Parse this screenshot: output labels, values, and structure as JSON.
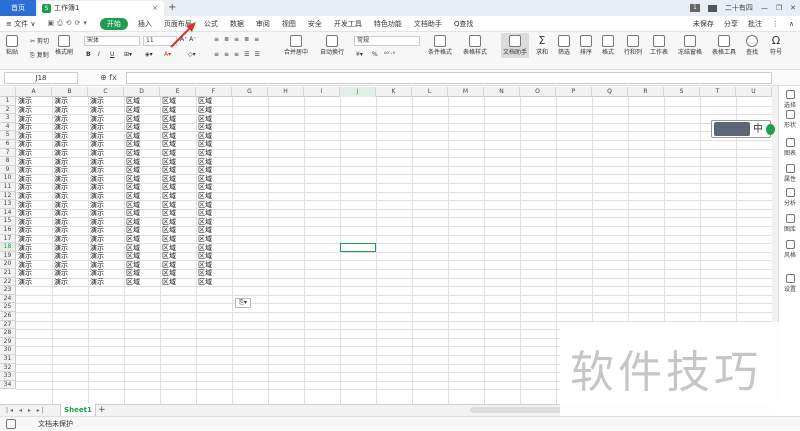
{
  "titlebar": {
    "home_tab": "首页",
    "doc_tab": "工作簿1",
    "doc_icon": "S",
    "close": "×",
    "plus": "+",
    "badge": "1",
    "user": "二十有四"
  },
  "menubar": {
    "file": "≡ 文件 ∨",
    "items": [
      "开始",
      "插入",
      "页面布局",
      "公式",
      "数据",
      "审阅",
      "视图",
      "安全",
      "开发工具",
      "特色功能",
      "文档助手",
      "Q查找"
    ],
    "active_index": 0,
    "right": [
      "未保存",
      "分享",
      "批注"
    ]
  },
  "ribbon": {
    "cut": "剪切",
    "copy": "复制",
    "paste": "粘贴",
    "format_painter": "格式刷",
    "font_name": "宋体",
    "font_size": "11",
    "bold": "B",
    "italic": "I",
    "underline": "U",
    "merge_center": "合并居中",
    "wrap": "自动换行",
    "number_format": "常规",
    "percent": "%",
    "cond_format": "条件格式",
    "table_style": "表格样式",
    "doc_helper": "文档助手",
    "sum": "求和",
    "filter": "筛选",
    "sort": "排序",
    "format": "格式",
    "rowcol": "行和列",
    "worksheet": "工作表",
    "freeze": "冻结窗格",
    "table_tools": "表格工具",
    "find": "查找",
    "symbol": "符号"
  },
  "formula": {
    "name_box": "J18",
    "fx": "fx",
    "value": ""
  },
  "grid": {
    "columns": [
      "A",
      "B",
      "C",
      "D",
      "E",
      "F",
      "G",
      "H",
      "I",
      "J",
      "K",
      "L",
      "M",
      "N",
      "O",
      "P",
      "Q",
      "R",
      "S",
      "T",
      "U"
    ],
    "rows": [
      "1",
      "2",
      "3",
      "4",
      "5",
      "6",
      "7",
      "8",
      "9",
      "10",
      "11",
      "12",
      "13",
      "14",
      "15",
      "16",
      "17",
      "18",
      "19",
      "20",
      "21",
      "22",
      "23",
      "24",
      "25",
      "26",
      "27",
      "28",
      "29",
      "30",
      "31",
      "32",
      "33",
      "34"
    ],
    "filled_rows": 22,
    "text_abc": "演示",
    "text_def": "区域",
    "selected_col_index": 9,
    "selected_row_index": 17
  },
  "paste_options": "⎘▾",
  "side_panel": [
    "选择",
    "形状",
    "图表",
    "属性",
    "分析",
    "图库",
    "风格",
    "设置"
  ],
  "sheet": {
    "tab": "Sheet1",
    "add": "+"
  },
  "status": {
    "protect": "文档未保护"
  },
  "watermark": "软件技巧",
  "ime": {
    "label": "中"
  },
  "colors": {
    "accent": "#1e9d4f",
    "home_tab": "#2b6fd6",
    "arrow": "#d9342b"
  }
}
